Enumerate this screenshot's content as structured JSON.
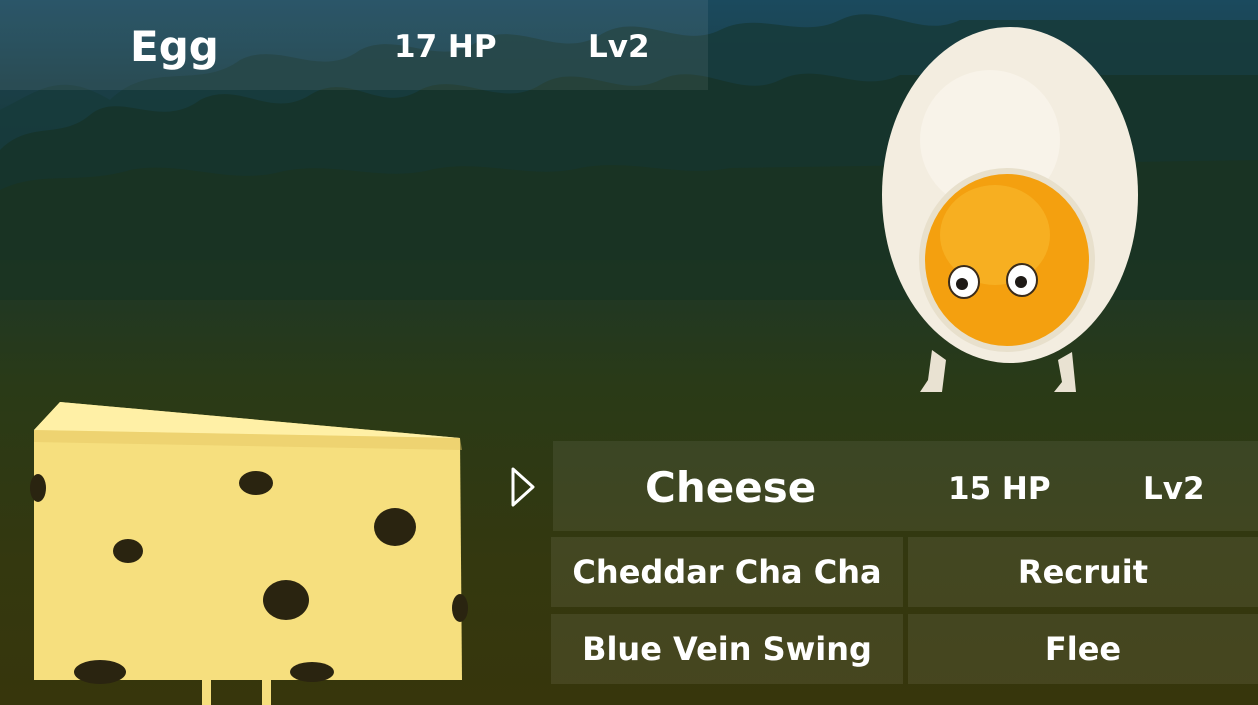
{
  "enemy": {
    "name": "Egg",
    "hp": "17 HP",
    "level": "Lv2"
  },
  "player": {
    "name": "Cheese",
    "hp": "15 HP",
    "level": "Lv2"
  },
  "actions": [
    {
      "label": "Cheddar Cha Cha"
    },
    {
      "label": "Recruit"
    },
    {
      "label": "Blue Vein Swing"
    },
    {
      "label": "Flee"
    }
  ],
  "colors": {
    "sky": "#1b4a5e",
    "ground": "#37360c",
    "yolk": "#f4a00f",
    "egg_white": "#f3ede0",
    "cheese": "#f6df7e",
    "text": "#ffffff"
  },
  "icons": {
    "cursor": "triangle-right-outline-icon"
  }
}
